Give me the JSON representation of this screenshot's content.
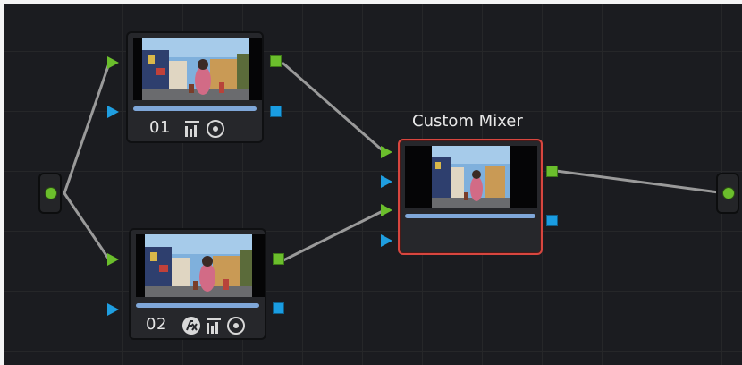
{
  "nodes": {
    "node1": {
      "label": "01",
      "icons": [
        "histogram-icon",
        "target-icon"
      ]
    },
    "node2": {
      "label": "02",
      "icons": [
        "fx-icon",
        "histogram-icon",
        "target-icon"
      ]
    },
    "mixer": {
      "title": "Custom Mixer"
    }
  },
  "colors": {
    "canvas": "#1b1c20",
    "rgb_port": "#6bbe2c",
    "alpha_port": "#1f9ee0",
    "selected_border": "#d8463f",
    "wire": "#9a9a9a"
  }
}
